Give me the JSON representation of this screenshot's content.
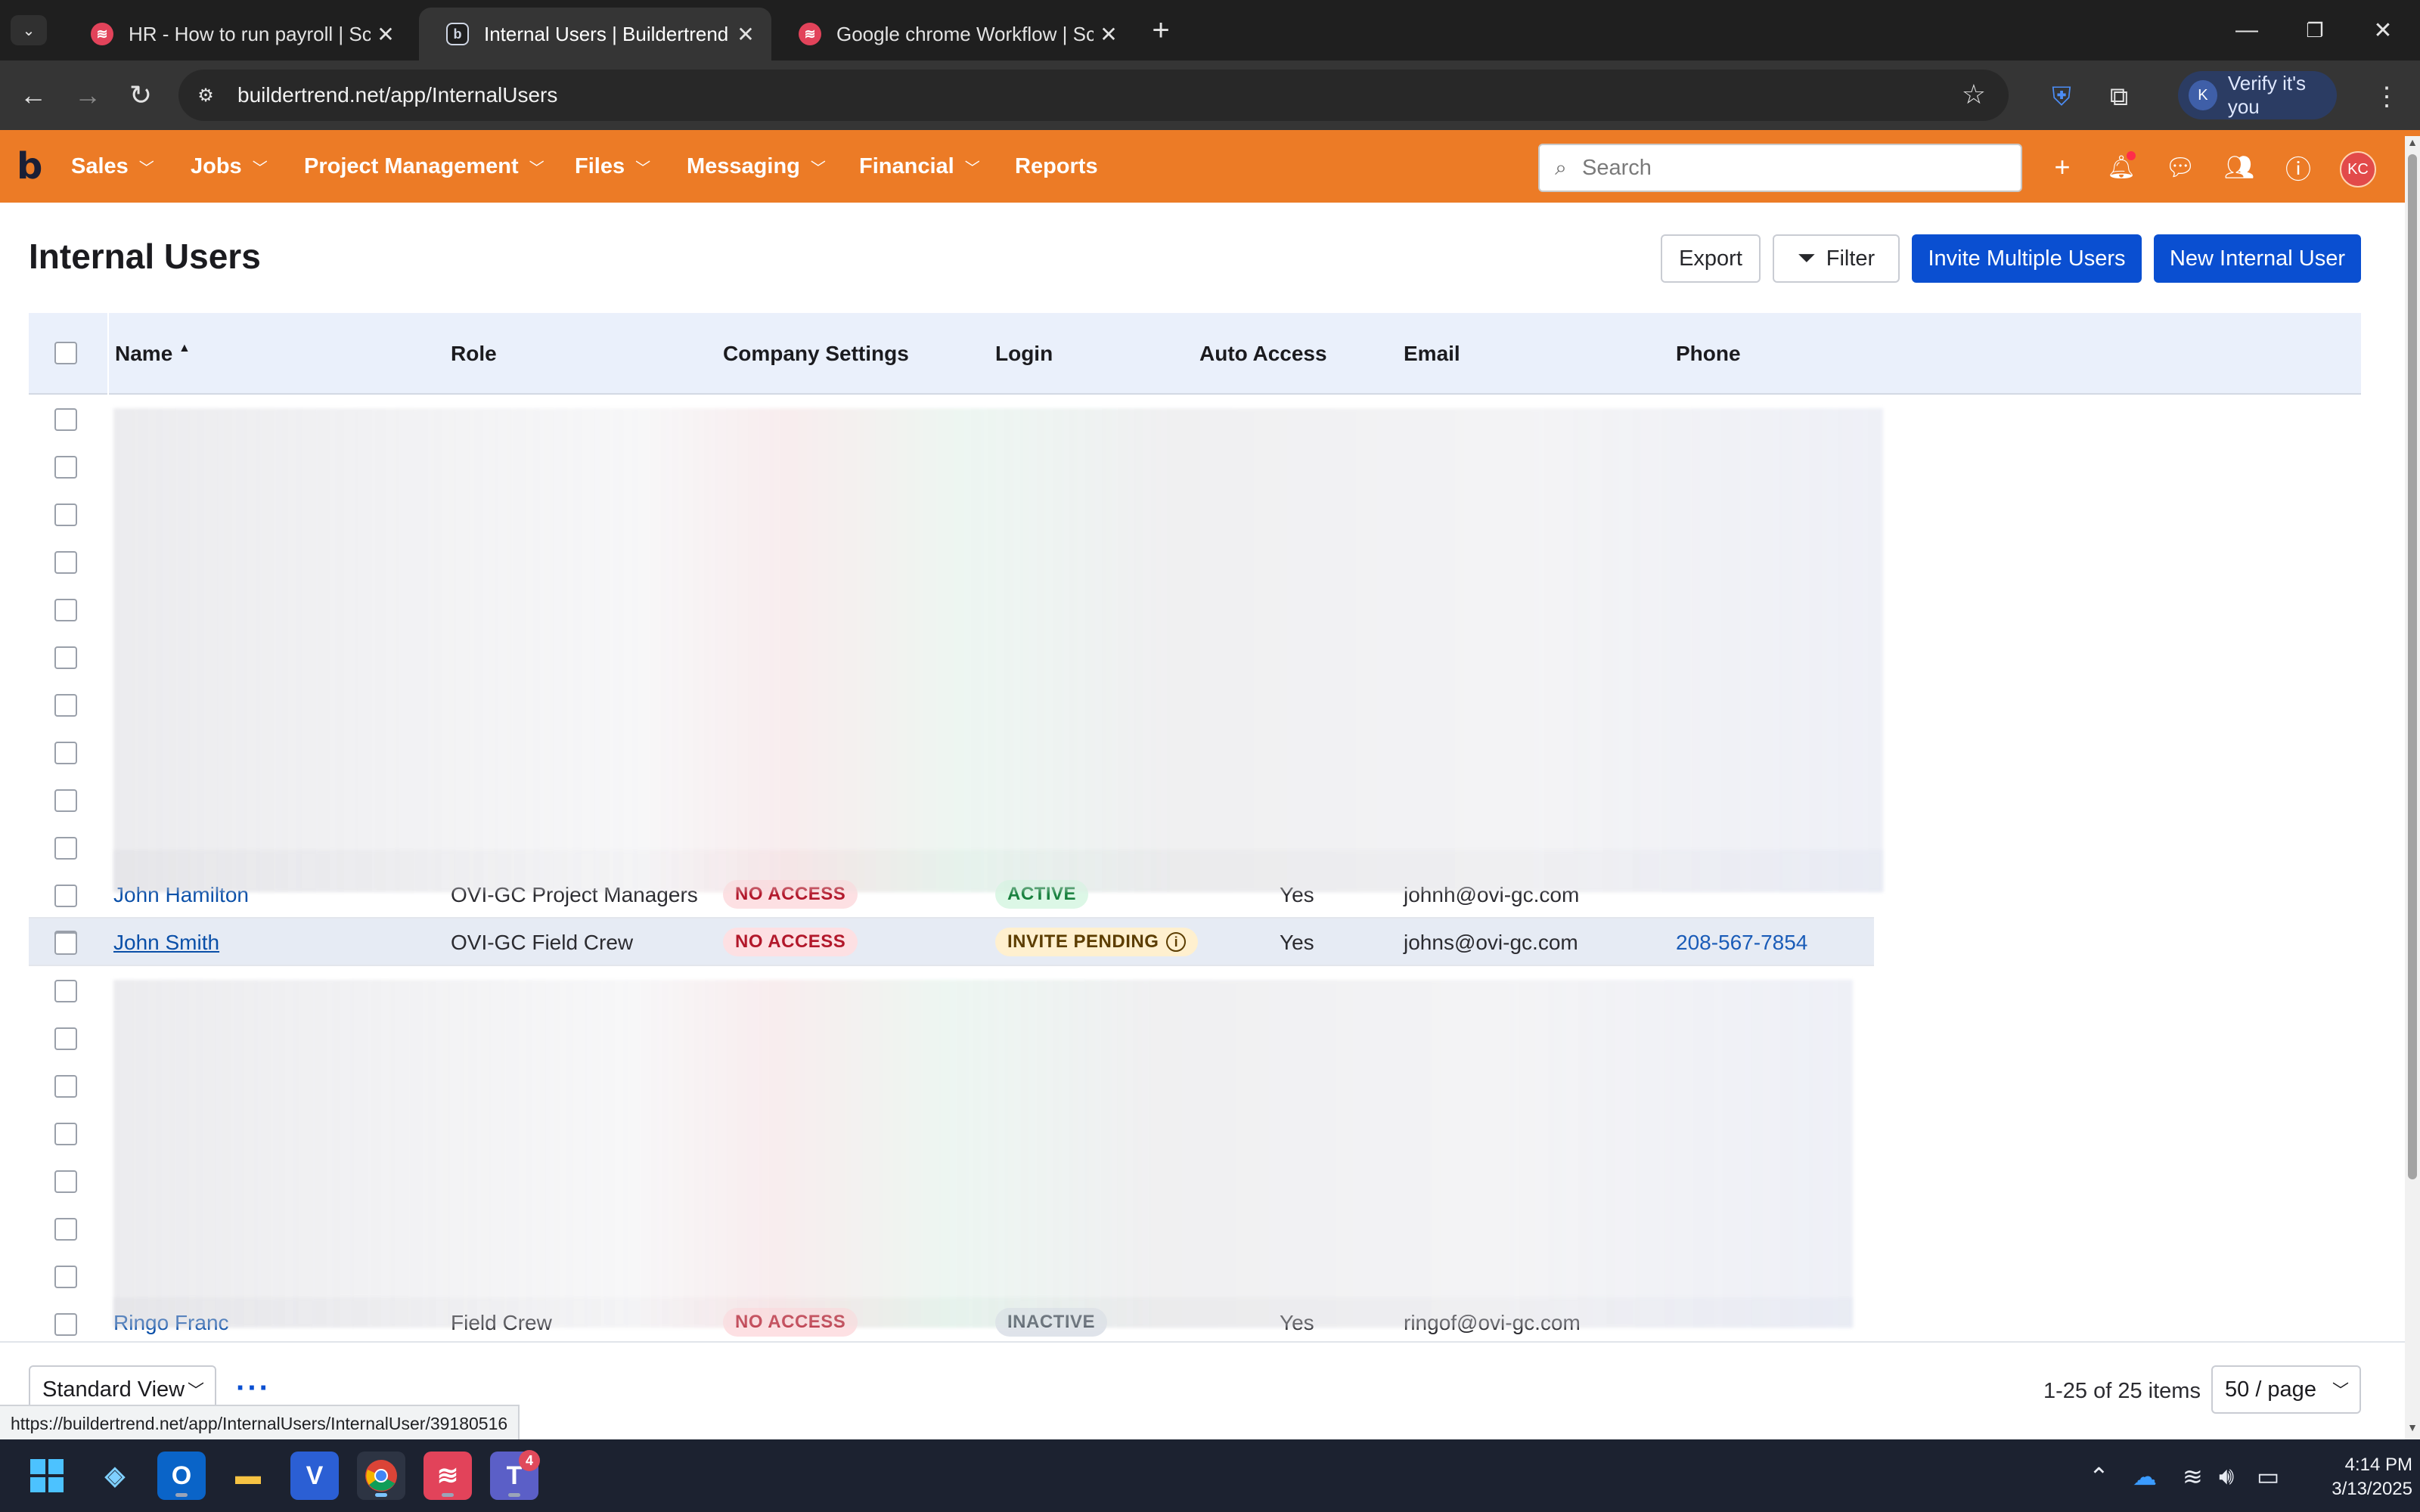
{
  "browser": {
    "tabs": [
      {
        "title": "HR - How to run payroll | Scribe",
        "icon": "scribe-icon"
      },
      {
        "title": "Internal Users | Buildertrend",
        "icon": "buildertrend-icon"
      },
      {
        "title": "Google chrome Workflow | Scri",
        "icon": "scribe-icon"
      }
    ],
    "active_tab": 1,
    "url": "buildertrend.net/app/InternalUsers",
    "verify_label": "Verify it's you",
    "profile_initial": "K"
  },
  "appnav": {
    "logo": "b",
    "menus": [
      {
        "label": "Sales",
        "has_dropdown": true
      },
      {
        "label": "Jobs",
        "has_dropdown": true
      },
      {
        "label": "Project Management",
        "has_dropdown": true
      },
      {
        "label": "Files",
        "has_dropdown": true
      },
      {
        "label": "Messaging",
        "has_dropdown": true
      },
      {
        "label": "Financial",
        "has_dropdown": true
      },
      {
        "label": "Reports",
        "has_dropdown": false
      }
    ],
    "search_placeholder": "Search",
    "user_initials": "KC",
    "accent": "#ec7b26"
  },
  "page": {
    "title": "Internal Users",
    "actions": {
      "export": "Export",
      "filter": "Filter",
      "invite_multiple": "Invite Multiple Users",
      "new_user": "New Internal User"
    }
  },
  "table": {
    "columns": [
      "Name",
      "Role",
      "Company Settings",
      "Login",
      "Auto Access",
      "Email",
      "Phone"
    ],
    "sort_indicator": "▲",
    "rows": [
      {
        "name": "John Hamilton",
        "role": "OVI-GC Project Managers",
        "settings": "NO ACCESS",
        "login": "ACTIVE",
        "auto": "Yes",
        "email": "johnh@ovi-gc.com",
        "phone": ""
      },
      {
        "name": "John Smith",
        "role": "OVI-GC Field Crew",
        "settings": "NO ACCESS",
        "login": "INVITE PENDING",
        "auto": "Yes",
        "email": "johns@ovi-gc.com",
        "phone": "208-567-7854"
      },
      {
        "name": "Ringo Franc",
        "role": "Field Crew",
        "settings": "NO ACCESS",
        "login": "INACTIVE",
        "auto": "Yes",
        "email": "ringof@ovi-gc.com",
        "phone": ""
      }
    ]
  },
  "footer": {
    "view": "Standard View",
    "more": "···",
    "range": "1-25 of 25 items",
    "page_size": "50 / page",
    "status_url": "https://buildertrend.net/app/InternalUsers/InternalUser/39180516"
  },
  "taskbar": {
    "time": "4:14 PM",
    "date": "3/13/2025",
    "teams_badge": "4"
  },
  "colors": {
    "primary": "#0a4fd1",
    "badge_red": "#b2182b",
    "badge_green": "#17803d",
    "badge_amber": "#5c3d00"
  }
}
